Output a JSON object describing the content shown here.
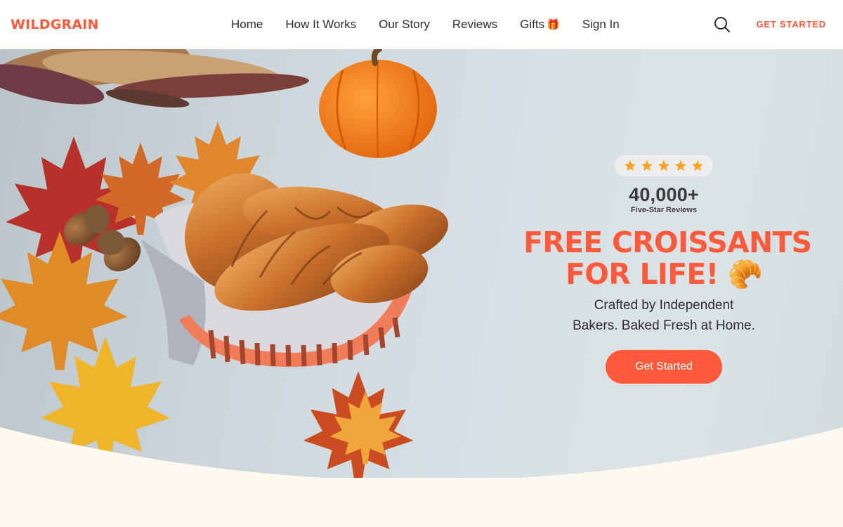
{
  "nav": {
    "logo": "WILDGRAIN",
    "links": [
      {
        "label": "Home"
      },
      {
        "label": "How It Works"
      },
      {
        "label": "Our Story"
      },
      {
        "label": "Reviews"
      },
      {
        "label": "Gifts",
        "emoji": "🎁"
      },
      {
        "label": "Sign In"
      }
    ],
    "search_icon": "search-icon",
    "cta": "GET STARTED"
  },
  "hero": {
    "rating_stars": 5,
    "review_count": "40,000+",
    "review_label": "Five-Star Reviews",
    "headline_line1": "FREE CROISSANTS",
    "headline_line2": "FOR LIFE!",
    "headline_emoji": "🥐",
    "subhead_line1": "Crafted by Independent",
    "subhead_line2": "Bakers. Baked Fresh at Home.",
    "cta": "Get Started"
  },
  "colors": {
    "brand": "#ff5a3c",
    "text": "#2d2d2d",
    "star": "#f5a623",
    "page_bg": "#fdf8f0"
  }
}
